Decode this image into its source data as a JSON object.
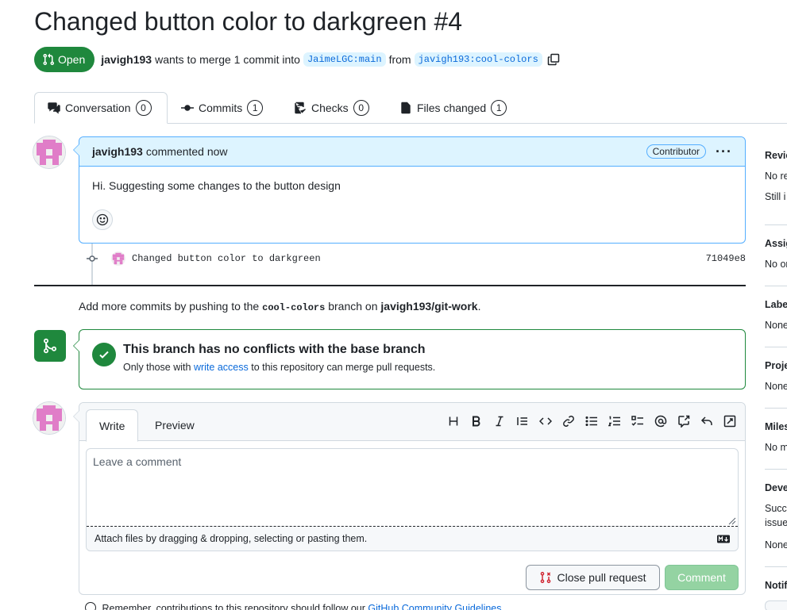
{
  "pr": {
    "title": "Changed button color to darkgreen #4",
    "state": "Open",
    "author": "javigh193",
    "merge_text": "wants to merge 1 commit into",
    "base_branch": "JaimeLGC:main",
    "from_text": "from",
    "head_branch": "javigh193:cool-colors"
  },
  "tabs": [
    {
      "label": "Conversation",
      "count": "0",
      "icon": "comment-discussion-icon"
    },
    {
      "label": "Commits",
      "count": "1",
      "icon": "git-commit-icon"
    },
    {
      "label": "Checks",
      "count": "0",
      "icon": "checklist-icon"
    },
    {
      "label": "Files changed",
      "count": "1",
      "icon": "file-diff-icon"
    }
  ],
  "comment": {
    "author": "javigh193",
    "action": "commented now",
    "role": "Contributor",
    "body": "Hi. Suggesting some changes to the button design"
  },
  "commit": {
    "message": "Changed button color to darkgreen",
    "sha": "71049e8"
  },
  "push_note": {
    "prefix": "Add more commits by pushing to the",
    "branch": "cool-colors",
    "middle": "branch on",
    "repo": "javigh193/git-work",
    "suffix": "."
  },
  "merge": {
    "title": "This branch has no conflicts with the base branch",
    "sub_prefix": "Only those with",
    "sub_link": "write access",
    "sub_suffix": "to this repository can merge pull requests."
  },
  "editor": {
    "tab_write": "Write",
    "tab_preview": "Preview",
    "placeholder": "Leave a comment",
    "attach_text": "Attach files by dragging & dropping, selecting or pasting them.",
    "close_button": "Close pull request",
    "comment_button": "Comment"
  },
  "remember": {
    "prefix": "Remember, contributions to this repository should follow our",
    "link": "GitHub Community Guidelines"
  },
  "sidebar": {
    "reviewers_h": "Revie",
    "reviewers_t1": "No re",
    "reviewers_t2": "Still i",
    "assignees_h": "Assig",
    "assignees_t": "No on",
    "labels_h": "Labe",
    "labels_t": "None",
    "projects_h": "Proje",
    "projects_t": "None",
    "milestone_h": "Miles",
    "milestone_t": "No m",
    "dev_h": "Deve",
    "dev_t1": "Succ",
    "dev_t2": "issue",
    "dev_t3": "None",
    "notif_h": "Notif"
  },
  "colors": {
    "open_green": "#1f883d",
    "link_blue": "#0969da",
    "comment_header_bg": "#ddf4ff",
    "avatar_pink": "#e07dc8"
  }
}
